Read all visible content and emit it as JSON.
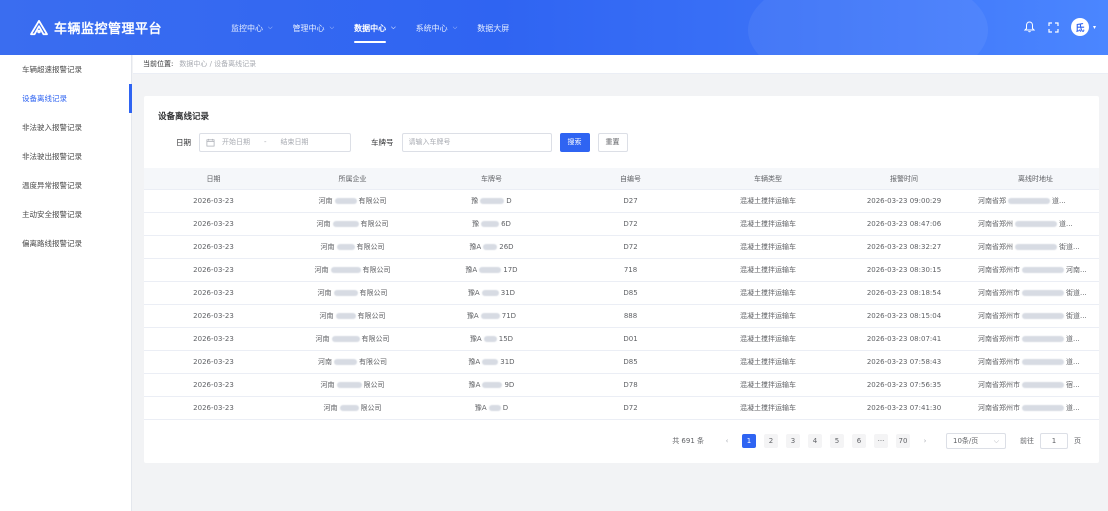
{
  "app": {
    "title": "车辆监控管理平台"
  },
  "nav": [
    {
      "label": "监控中心",
      "has_chevron": true,
      "active": false
    },
    {
      "label": "管理中心",
      "has_chevron": true,
      "active": false
    },
    {
      "label": "数据中心",
      "has_chevron": true,
      "active": true
    },
    {
      "label": "系统中心",
      "has_chevron": true,
      "active": false
    },
    {
      "label": "数据大屏",
      "has_chevron": false,
      "active": false
    }
  ],
  "header_icons": [
    "bell-icon",
    "fullscreen-icon"
  ],
  "user": {
    "avatar_text": "氐"
  },
  "sidebar": {
    "items": [
      {
        "label": "车辆超速报警记录",
        "active": false
      },
      {
        "label": "设备离线记录",
        "active": true
      },
      {
        "label": "非法驶入报警记录",
        "active": false
      },
      {
        "label": "非法驶出报警记录",
        "active": false
      },
      {
        "label": "温度异常报警记录",
        "active": false
      },
      {
        "label": "主动安全报警记录",
        "active": false
      },
      {
        "label": "偏离路线报警记录",
        "active": false
      }
    ]
  },
  "breadcrumb": {
    "current_label": "当前位置:",
    "path": "数据中心 / 设备离线记录"
  },
  "card": {
    "title": "设备离线记录"
  },
  "filters": {
    "date_label": "日期",
    "start_placeholder": "开始日期",
    "range_sep": "-",
    "end_placeholder": "结束日期",
    "plate_label": "车牌号",
    "plate_placeholder": "请输入车牌号",
    "search_label": "搜索",
    "reset_label": "重置"
  },
  "table": {
    "columns": [
      "日期",
      "所属企业",
      "车牌号",
      "自编号",
      "车辆类型",
      "报警时间",
      "离线时地址"
    ],
    "rows": [
      {
        "date": "2026-03-23",
        "company": [
          "河南",
          "有限公司"
        ],
        "plate": [
          "豫",
          "D"
        ],
        "code": "D27",
        "type": "混凝土搅拌运输车",
        "time": "2026-03-23 09:00:29",
        "address": [
          "河南省郑",
          "道..."
        ]
      },
      {
        "date": "2026-03-23",
        "company": [
          "河南",
          "有限公司"
        ],
        "plate": [
          "豫",
          "6D"
        ],
        "code": "D72",
        "type": "混凝土搅拌运输车",
        "time": "2026-03-23 08:47:06",
        "address": [
          "河南省郑州",
          "道..."
        ]
      },
      {
        "date": "2026-03-23",
        "company": [
          "河南",
          "有限公司"
        ],
        "plate": [
          "豫A",
          "26D"
        ],
        "code": "D72",
        "type": "混凝土搅拌运输车",
        "time": "2026-03-23 08:32:27",
        "address": [
          "河南省郑州",
          "街道..."
        ]
      },
      {
        "date": "2026-03-23",
        "company": [
          "河南",
          "有限公司"
        ],
        "plate": [
          "豫A",
          "17D"
        ],
        "code": "718",
        "type": "混凝土搅拌运输车",
        "time": "2026-03-23 08:30:15",
        "address": [
          "河南省郑州市",
          "河南..."
        ]
      },
      {
        "date": "2026-03-23",
        "company": [
          "河南",
          "有限公司"
        ],
        "plate": [
          "豫A",
          "31D"
        ],
        "code": "D85",
        "type": "混凝土搅拌运输车",
        "time": "2026-03-23 08:18:54",
        "address": [
          "河南省郑州市",
          "街道..."
        ]
      },
      {
        "date": "2026-03-23",
        "company": [
          "河南",
          "有限公司"
        ],
        "plate": [
          "豫A",
          "71D"
        ],
        "code": "888",
        "type": "混凝土搅拌运输车",
        "time": "2026-03-23 08:15:04",
        "address": [
          "河南省郑州市",
          "街道..."
        ]
      },
      {
        "date": "2026-03-23",
        "company": [
          "河南",
          "有限公司"
        ],
        "plate": [
          "豫A",
          "15D"
        ],
        "code": "D01",
        "type": "混凝土搅拌运输车",
        "time": "2026-03-23 08:07:41",
        "address": [
          "河南省郑州市",
          "道..."
        ]
      },
      {
        "date": "2026-03-23",
        "company": [
          "河南",
          "有限公司"
        ],
        "plate": [
          "豫A",
          "31D"
        ],
        "code": "D85",
        "type": "混凝土搅拌运输车",
        "time": "2026-03-23 07:58:43",
        "address": [
          "河南省郑州市",
          "道..."
        ]
      },
      {
        "date": "2026-03-23",
        "company": [
          "河南",
          "限公司"
        ],
        "plate": [
          "豫A",
          "9D"
        ],
        "code": "D78",
        "type": "混凝土搅拌运输车",
        "time": "2026-03-23 07:56:35",
        "address": [
          "河南省郑州市",
          "宿..."
        ]
      },
      {
        "date": "2026-03-23",
        "company": [
          "河南",
          "限公司"
        ],
        "plate": [
          "豫A",
          "D"
        ],
        "code": "D72",
        "type": "混凝土搅拌运输车",
        "time": "2026-03-23 07:41:30",
        "address": [
          "河南省郑州市",
          "道..."
        ]
      }
    ]
  },
  "pagination": {
    "total_text": "共 691 条",
    "pages": [
      "1",
      "2",
      "3",
      "4",
      "5",
      "6",
      "···",
      "70"
    ],
    "current": "1",
    "page_size": "10条/页",
    "goto_label": "前往",
    "goto_value": "1",
    "page_suffix": "页"
  }
}
